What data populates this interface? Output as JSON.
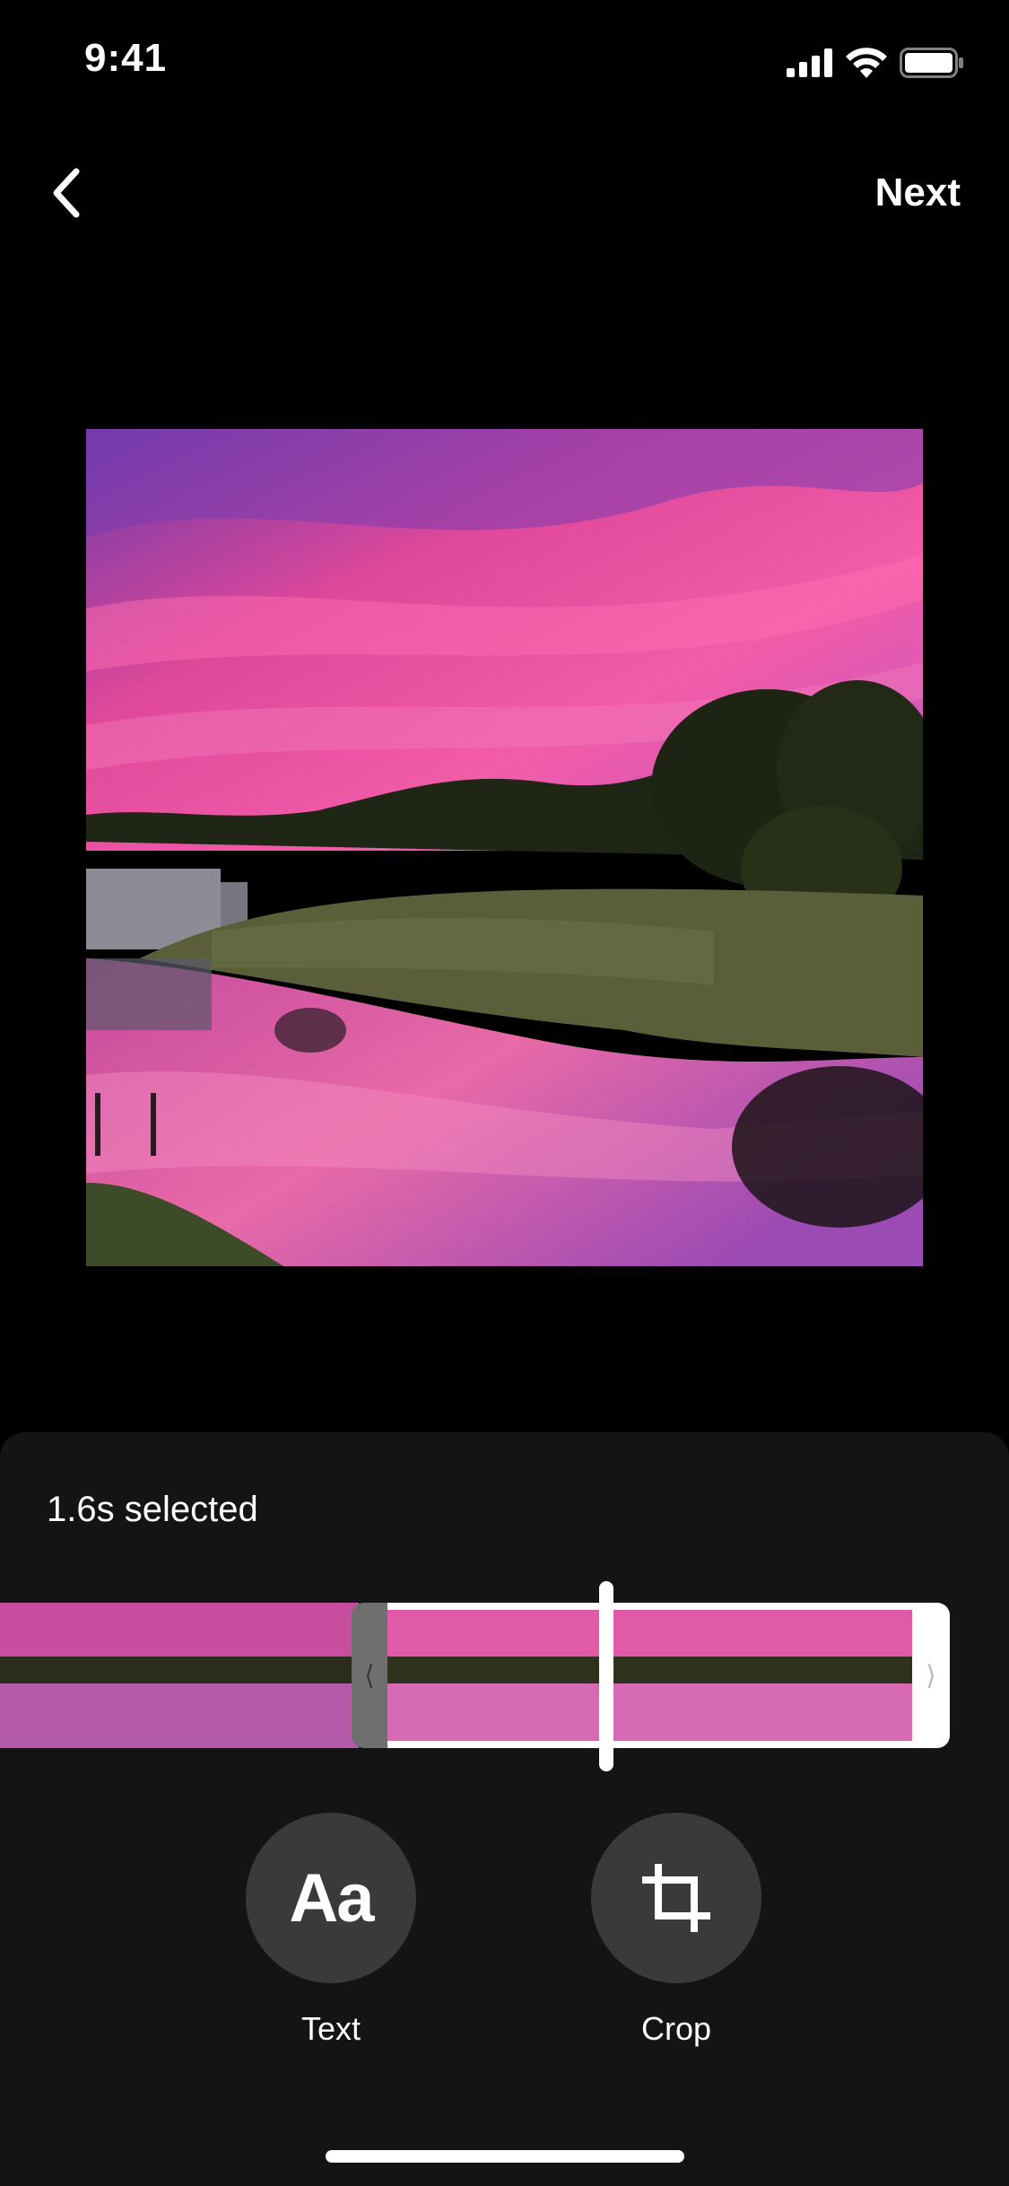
{
  "status_bar": {
    "time": "9:41",
    "icons": [
      "cellular-signal-icon",
      "wifi-icon",
      "battery-icon"
    ]
  },
  "nav": {
    "back_icon": "chevron-left-icon",
    "next_label": "Next"
  },
  "preview": {
    "description_icon": "video-preview"
  },
  "timeline": {
    "selected_label": "1.6s selected",
    "left_handle_glyph": "⟨",
    "right_handle_glyph": "⟩"
  },
  "tools": [
    {
      "id": "text",
      "glyph": "Aa",
      "label": "Text"
    },
    {
      "id": "crop",
      "icon": "crop-icon",
      "label": "Crop"
    }
  ],
  "colors": {
    "background": "#000000",
    "panel": "#141414",
    "tool_circle": "#3a3a3a",
    "accent": "#ffffff"
  }
}
